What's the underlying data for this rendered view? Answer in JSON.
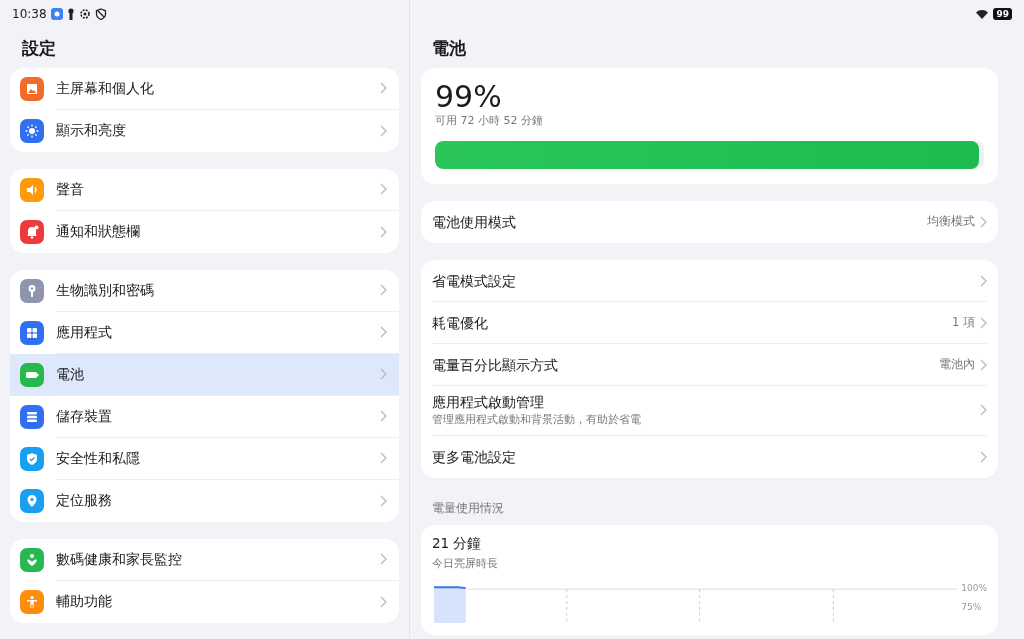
{
  "status_bar": {
    "time": "10:38",
    "battery": "99"
  },
  "sidebar": {
    "title": "設定",
    "groups": [
      {
        "items": [
          {
            "label": "主屏幕和個人化",
            "color": "#f26b2a",
            "selected": false
          },
          {
            "label": "顯示和亮度",
            "color": "#2f6ff0",
            "selected": false
          }
        ]
      },
      {
        "items": [
          {
            "label": "聲音",
            "color": "#ff9a0a",
            "selected": false
          },
          {
            "label": "通知和狀態欄",
            "color": "#ec3b3b",
            "selected": false
          }
        ]
      },
      {
        "items": [
          {
            "label": "生物識別和密碼",
            "color": "#8e95ad",
            "selected": false
          },
          {
            "label": "應用程式",
            "color": "#2f6ff0",
            "selected": false
          },
          {
            "label": "電池",
            "color": "#27b84f",
            "selected": true
          },
          {
            "label": "儲存裝置",
            "color": "#2f6ff0",
            "selected": false
          },
          {
            "label": "安全性和私隱",
            "color": "#18a0f0",
            "selected": false
          },
          {
            "label": "定位服務",
            "color": "#18a0f0",
            "selected": false
          }
        ]
      },
      {
        "items": [
          {
            "label": "數碼健康和家長監控",
            "color": "#27b84f",
            "selected": false
          },
          {
            "label": "輔助功能",
            "color": "#ff8c0a",
            "selected": false
          }
        ]
      }
    ]
  },
  "detail": {
    "title": "電池",
    "battery": {
      "percent": "99%",
      "remaining": "可用 72 小時 52 分鐘",
      "level": 0.99
    },
    "mode": {
      "label": "電池使用模式",
      "value": "均衡模式"
    },
    "settings": [
      {
        "label": "省電模式設定"
      },
      {
        "label": "耗電優化",
        "value": "1 項"
      },
      {
        "label": "電量百分比顯示方式",
        "value": "電池內"
      },
      {
        "label": "應用程式啟動管理",
        "subtitle": "管理應用程式啟動和背景活動，有助於省電"
      },
      {
        "label": "更多電池設定"
      }
    ],
    "usage_heading": "電量使用情況",
    "usage": {
      "value": "21 分鐘",
      "caption": "今日亮屏時長",
      "axis_labels": [
        "100%",
        "75%"
      ]
    }
  }
}
